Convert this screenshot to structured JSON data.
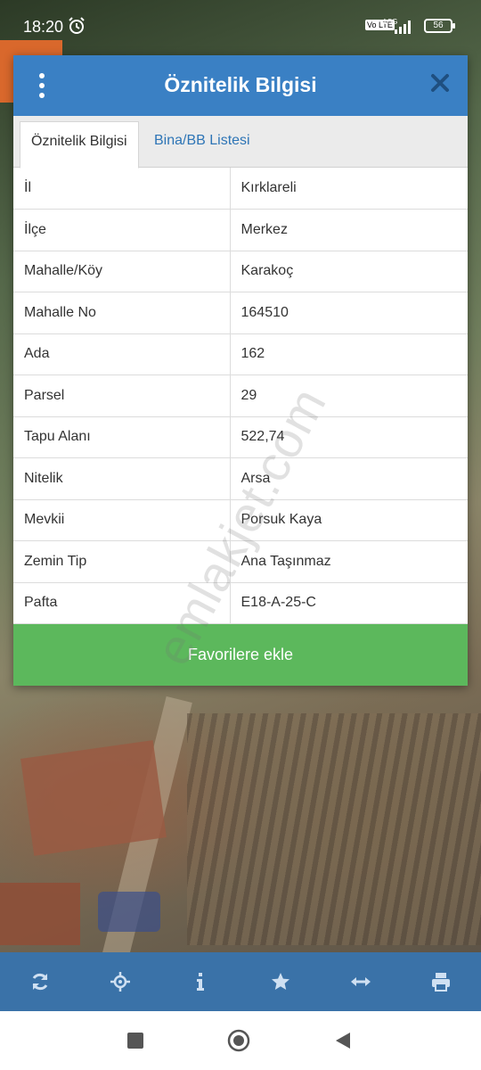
{
  "status_bar": {
    "time": "18:20",
    "network_label": "Vo LTE",
    "network_gen": "4.5G",
    "battery": "56"
  },
  "dialog": {
    "title": "Öznitelik Bilgisi",
    "tabs": [
      {
        "label": "Öznitelik Bilgisi",
        "active": true
      },
      {
        "label": "Bina/BB Listesi",
        "active": false
      }
    ],
    "rows": [
      {
        "key": "İl",
        "value": "Kırklareli"
      },
      {
        "key": "İlçe",
        "value": "Merkez"
      },
      {
        "key": "Mahalle/Köy",
        "value": "Karakoç"
      },
      {
        "key": "Mahalle No",
        "value": "164510"
      },
      {
        "key": "Ada",
        "value": "162"
      },
      {
        "key": "Parsel",
        "value": "29"
      },
      {
        "key": "Tapu Alanı",
        "value": "522,74"
      },
      {
        "key": "Nitelik",
        "value": "Arsa"
      },
      {
        "key": "Mevkii",
        "value": "Porsuk Kaya"
      },
      {
        "key": "Zemin Tip",
        "value": "Ana Taşınmaz"
      },
      {
        "key": "Pafta",
        "value": "E18-A-25-C"
      }
    ],
    "favorite_button": "Favorilere ekle"
  },
  "watermark": "emlakjet.com",
  "toolbar": {
    "icons": [
      "refresh-icon",
      "locate-icon",
      "info-icon",
      "star-icon",
      "measure-icon",
      "print-icon"
    ]
  },
  "navbar": {
    "icons": [
      "recents-icon",
      "home-icon",
      "back-icon"
    ]
  },
  "colors": {
    "header": "#3a80c4",
    "tab_link": "#2e75b6",
    "favorite_button": "#5cb85c",
    "toolbar": "#3a72a8"
  }
}
